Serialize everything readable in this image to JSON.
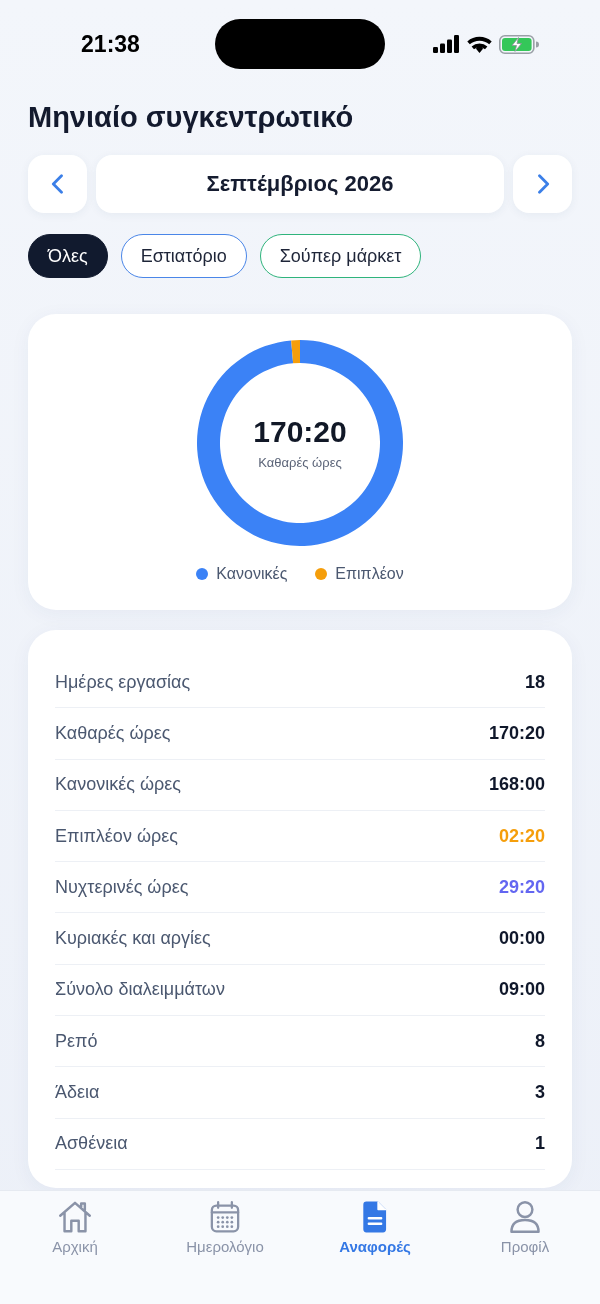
{
  "status_bar": {
    "time": "21:38"
  },
  "title": "Μηνιαίο συγκεντρωτικό",
  "month_nav": {
    "month": "Σεπτέμβριος 2026"
  },
  "filters": [
    {
      "label": "Όλες",
      "selected": true,
      "color": "#111a2e"
    },
    {
      "label": "Εστιατόριο",
      "selected": false,
      "color": "#4a86e8"
    },
    {
      "label": "Σούπερ μάρκετ",
      "selected": false,
      "color": "#2fb47c"
    }
  ],
  "summary_chart": {
    "total": "170:20",
    "total_label": "Καθαρές ώρες",
    "chart_data": {
      "type": "donut",
      "categories": [
        "Κανονικές",
        "Επιπλέον"
      ],
      "values": [
        98.63,
        1.37
      ],
      "colors": [
        "#3b82f6",
        "#f59e0b"
      ]
    }
  },
  "stats": [
    {
      "label": "Ημέρες εργασίας",
      "value": "18",
      "color": "#0f172a"
    },
    {
      "label": "Καθαρές ώρες",
      "value": "170:20",
      "color": "#0f172a"
    },
    {
      "label": "Κανονικές ώρες",
      "value": "168:00",
      "color": "#0f172a"
    },
    {
      "label": "Επιπλέον ώρες",
      "value": "02:20",
      "color": "#f59e0b"
    },
    {
      "label": "Νυχτερινές ώρες",
      "value": "29:20",
      "color": "#6366f1"
    },
    {
      "label": "Κυριακές και αργίες",
      "value": "00:00",
      "color": "#0f172a"
    },
    {
      "label": "Σύνολο διαλειμμάτων",
      "value": "09:00",
      "color": "#0f172a"
    },
    {
      "label": "Ρεπό",
      "value": "8",
      "color": "#0f172a"
    },
    {
      "label": "Άδεια",
      "value": "3",
      "color": "#0f172a"
    },
    {
      "label": "Ασθένεια",
      "value": "1",
      "color": "#0f172a"
    }
  ],
  "tab_bar": [
    {
      "label": "Αρχική",
      "kind": "home",
      "selected": false
    },
    {
      "label": "Ημερολόγιο",
      "kind": "calendar",
      "selected": false
    },
    {
      "label": "Αναφορές",
      "kind": "reports",
      "selected": true
    },
    {
      "label": "Προφίλ",
      "kind": "profile",
      "selected": false
    }
  ]
}
